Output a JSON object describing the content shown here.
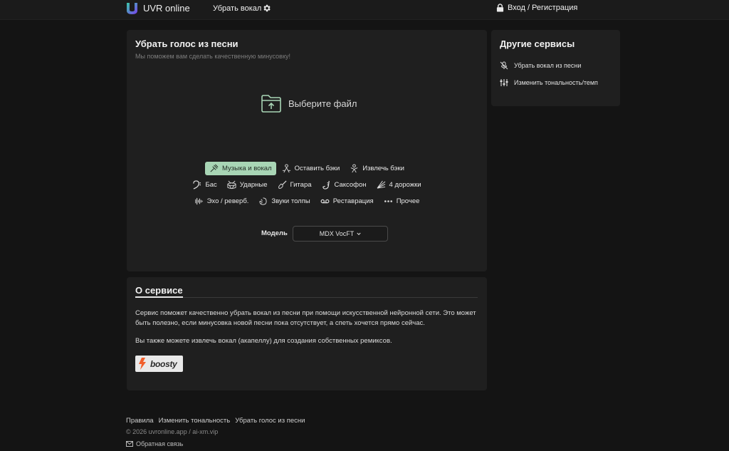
{
  "navbar": {
    "brand": "UVR online",
    "link_remove_vocals": "Убрать вокал",
    "login": "Вход / Регистрация"
  },
  "main": {
    "title": "Убрать голос из песни",
    "subtitle": "Мы поможем вам сделать качественную минусовку!",
    "upload_label": "Выберите файл",
    "options_row1": [
      {
        "label": "Музыка и вокал",
        "icon": "music-vocal-icon",
        "active": true
      },
      {
        "label": "Оставить бэки",
        "icon": "backing-keep-icon",
        "active": false
      },
      {
        "label": "Извлечь бэки",
        "icon": "backing-extract-icon",
        "active": false
      }
    ],
    "options_row2": [
      {
        "label": "Бас",
        "icon": "bass-clef-icon"
      },
      {
        "label": "Ударные",
        "icon": "drum-icon"
      },
      {
        "label": "Гитара",
        "icon": "guitar-icon"
      },
      {
        "label": "Саксофон",
        "icon": "saxophone-icon"
      },
      {
        "label": "4 дорожки",
        "icon": "tracks-icon"
      }
    ],
    "options_row3": [
      {
        "label": "Эхо / реверб.",
        "icon": "echo-icon"
      },
      {
        "label": "Звуки толпы",
        "icon": "crowd-icon"
      },
      {
        "label": "Реставрация",
        "icon": "cassette-icon"
      },
      {
        "label": "Прочее",
        "icon": "dots-icon"
      }
    ],
    "model_label": "Модель",
    "model_value": "MDX VocFT"
  },
  "side": {
    "title": "Другие сервисы",
    "items": [
      {
        "label": "Убрать вокал из песни",
        "icon": "mic-off-icon"
      },
      {
        "label": "Изменить тональность/темп",
        "icon": "sliders-icon"
      }
    ]
  },
  "about": {
    "title": "О сервисе",
    "paragraph1": "Сервис поможет качественно убрать вокал из песни при помощи искусственной нейронной сети. Это может быть полезно, если минусовка новой песни пока отсутствует, а спеть хочется прямо сейчас.",
    "paragraph2": "Вы также можете извлечь вокал (акапеллу) для создания собственных ремиксов.",
    "boosty_label": "boosty"
  },
  "footer": {
    "links": [
      "Правила",
      "Изменить тональность",
      "Убрать голос из песни"
    ],
    "copyright": "© 2026 uvronline.app / ai-xm.vip",
    "feedback": "Обратная связь"
  },
  "colors": {
    "background": "#141414",
    "card": "#1f1f1f",
    "accent": "#a8d5b5",
    "logo_gradient_start": "#39c9a8",
    "logo_gradient_end": "#7a3cf0"
  }
}
